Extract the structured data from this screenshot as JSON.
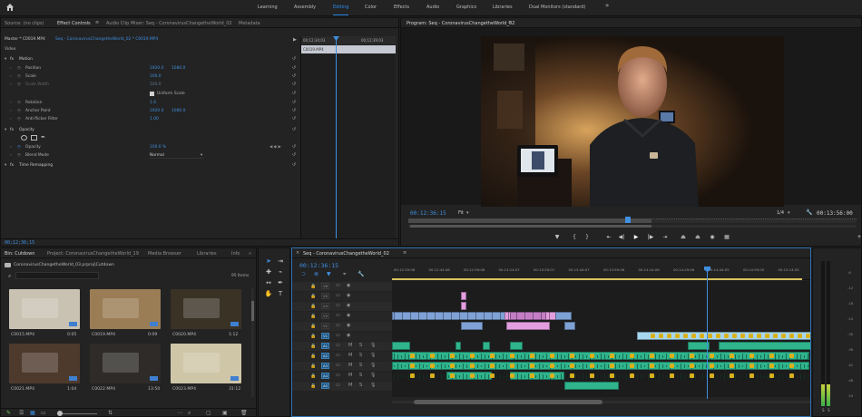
{
  "topbar": {
    "workspaces": [
      "Learning",
      "Assembly",
      "Editing",
      "Color",
      "Effects",
      "Audio",
      "Graphics",
      "Libraries",
      "Dual Monitors (standard)"
    ],
    "active": "Editing",
    "more": "»"
  },
  "source_panel": {
    "tabs": [
      "Source: (no clips)",
      "Effect Controls",
      "Audio Clip Mixer: Seq - CoronavirusChangetheWorld_02",
      "Metadata"
    ],
    "active_tab": "Effect Controls",
    "menu_icon": "≡",
    "clip_header": "Master * C0019.MP4",
    "clip_header_link": "Seq - CoronavirusChangetheWorld_02 * C0019.MP4",
    "mini_timeline_start": "00;12;34;03",
    "mini_timeline_end": "00;12;39;03",
    "mini_clip_name": "C0019.MP4",
    "section_video": "Video",
    "properties": [
      {
        "label": "Motion",
        "type": "group",
        "fx": true
      },
      {
        "label": "Position",
        "v1": "1920.0",
        "v2": "1080.0"
      },
      {
        "label": "Scale",
        "v1": "100.0"
      },
      {
        "label": "Scale Width",
        "v1": "100.0",
        "dim": true
      },
      {
        "label": "Uniform Scale",
        "type": "checkbox"
      },
      {
        "label": "Rotation",
        "v1": "1.6"
      },
      {
        "label": "Anchor Point",
        "v1": "1920.0",
        "v2": "1080.0"
      },
      {
        "label": "Anti-flicker Filter",
        "v1": "1.00"
      },
      {
        "label": "Opacity",
        "type": "group",
        "fx": true
      },
      {
        "label": "mask-tools",
        "type": "masks"
      },
      {
        "label": "Opacity",
        "v1": "100.0 %"
      },
      {
        "label": "Blend Mode",
        "v1": "Normal",
        "type": "select"
      },
      {
        "label": "Time Remapping",
        "type": "group",
        "fx": true
      }
    ],
    "footer_timecode": "00;12;36;15"
  },
  "program_monitor": {
    "title": "Program: Seq - CoronavirusChangetheWorld_02",
    "menu_icon": "≡",
    "timecode": "00:12:36:15",
    "fit": "Fit",
    "resolution": "1/4",
    "duration": "00:13:56:00",
    "settings_icon": "wrench-icon"
  },
  "project_panel": {
    "tabs": [
      "Bin: Cutdown",
      "Project: CoronavirusChangetheWorld_19",
      "Media Browser",
      "Libraries",
      "Info"
    ],
    "active_tab": "Bin: Cutdown",
    "more": "»",
    "path": "CoronavirusChangetheWorld_03.prproj\\Cutdown",
    "search_placeholder": "",
    "item_count": "95 Items",
    "items": [
      {
        "name": "C0015.MP4",
        "dur": "0:05",
        "color": "#c9c2b2"
      },
      {
        "name": "C0019.MP4",
        "dur": "0:09",
        "color": "#9a7d55"
      },
      {
        "name": "C0020.MP4",
        "dur": "1:12",
        "color": "#3b3226"
      },
      {
        "name": "C0021.MP4",
        "dur": "1:04",
        "color": "#4e3a2c"
      },
      {
        "name": "C0022.MP4",
        "dur": "13:50",
        "color": "#2e2b28"
      },
      {
        "name": "C0023.MP4",
        "dur": "31:12",
        "color": "#cfc6a8"
      }
    ]
  },
  "tools": [
    "selection-tool",
    "track-select-tool",
    "ripple-tool",
    "razor-tool",
    "slip-tool",
    "pen-tool",
    "hand-tool",
    "type-tool"
  ],
  "timeline": {
    "title": "Seq - CoronavirusChangetheWorld_02",
    "timecode": "00:12:36:15",
    "ruler": [
      "00:12:29:08",
      "00:12:44:08",
      "00:12:59:08",
      "00:13:14:07",
      "00:13:29:07",
      "00:13:44:07",
      "00:13:59:06",
      "00:14:14:06",
      "00:14:29:06",
      "00:14:44:05",
      "00:14:59:05",
      "00:15:14:05"
    ],
    "video_tracks": [
      "V6",
      "V5",
      "V4",
      "V3",
      "V2",
      "V1"
    ],
    "audio_tracks": [
      "A1",
      "A2",
      "A3",
      "A4",
      "A5"
    ],
    "track_letters": [
      "M",
      "S"
    ]
  },
  "meter": {
    "labels": [
      "-6",
      "-12",
      "-18",
      "-24",
      "-30",
      "-36",
      "-42",
      "-48",
      "-54"
    ],
    "footer": [
      "S",
      "S"
    ]
  }
}
